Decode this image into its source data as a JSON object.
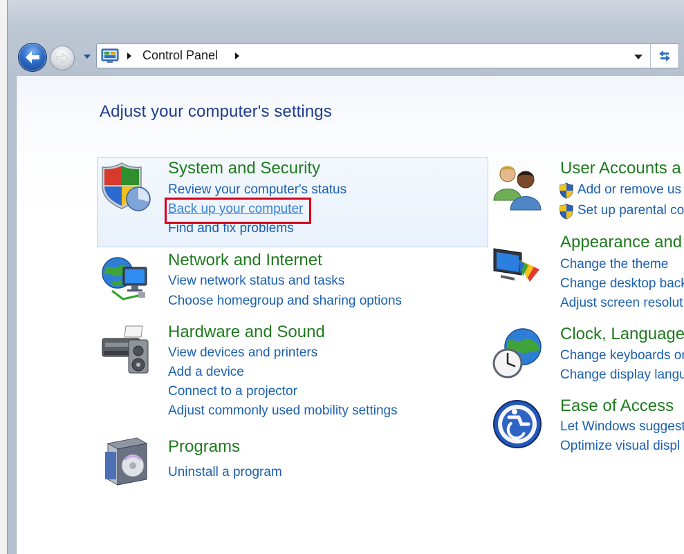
{
  "address_bar": {
    "crumb": "Control Panel"
  },
  "page": {
    "title": "Adjust your computer's settings"
  },
  "left_categories": [
    {
      "title": "System and Security",
      "links": [
        "Review your computer's status",
        "Back up your computer",
        "Find and fix problems"
      ]
    },
    {
      "title": "Network and Internet",
      "links": [
        "View network status and tasks",
        "Choose homegroup and sharing options"
      ]
    },
    {
      "title": "Hardware and Sound",
      "links": [
        "View devices and printers",
        "Add a device",
        "Connect to a projector",
        "Adjust commonly used mobility settings"
      ]
    },
    {
      "title": "Programs",
      "links": [
        "Uninstall a program"
      ]
    }
  ],
  "right_categories": [
    {
      "title": "User Accounts a",
      "links": [
        "Add or remove us",
        "Set up parental co"
      ]
    },
    {
      "title": "Appearance and",
      "links": [
        "Change the theme",
        "Change desktop back",
        "Adjust screen resolut"
      ]
    },
    {
      "title": "Clock, Language",
      "links": [
        "Change keyboards or",
        "Change display langu"
      ]
    },
    {
      "title": "Ease of Access",
      "links": [
        "Let Windows suggest",
        "Optimize visual displ"
      ]
    }
  ],
  "colors": {
    "category_title": "#1f7a1f",
    "link": "#1a5fb0",
    "page_title": "#1e3d8f",
    "highlight_border": "#d2001e"
  }
}
